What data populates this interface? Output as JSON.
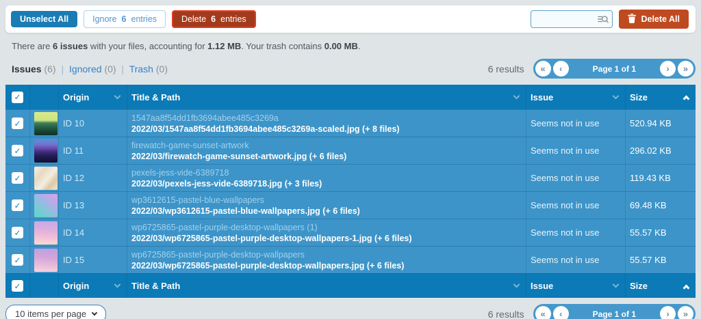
{
  "toolbar": {
    "unselect_all_label": "Unselect All",
    "ignore_button": {
      "pre": "Ignore ",
      "count": "6",
      "post": " entries"
    },
    "delete_button": {
      "pre": "Delete ",
      "count": "6",
      "post": " entries"
    },
    "search": {
      "value": "",
      "placeholder": ""
    },
    "delete_all_label": "Delete All"
  },
  "stats": {
    "part1": "There are ",
    "issues_count": "6 issues",
    "part2": " with your files, accounting for ",
    "total_size": "1.12 MB",
    "part3": ". Your trash contains ",
    "trash_size": "0.00 MB",
    "part4": "."
  },
  "tabs": {
    "issues_label": "Issues",
    "issues_count": "(6)",
    "ignored_label": "Ignored",
    "ignored_count": "(0)",
    "trash_label": "Trash",
    "trash_count": "(0)",
    "separator": "|"
  },
  "pagination": {
    "results": "6 results",
    "page_label": "Page 1 of 1",
    "first": "«",
    "prev": "‹",
    "next": "›",
    "last": "»"
  },
  "table": {
    "columns": {
      "origin": "Origin",
      "title_path": "Title & Path",
      "issue": "Issue",
      "size": "Size"
    },
    "sorted_by": "Size",
    "checkmark": "✓",
    "rows": [
      {
        "id": "ID 10",
        "thumbnail": "green-mountain-landscape",
        "title": "1547aa8f54dd1fb3694abee485c3269a",
        "path": "2022/03/1547aa8f54dd1fb3694abee485c3269a-scaled.jpg (+ 8 files)",
        "issue": "Seems not in use",
        "size": "520.94 KB"
      },
      {
        "id": "ID 11",
        "thumbnail": "firewatch-sunset-mountains",
        "title": "firewatch-game-sunset-artwork",
        "path": "2022/03/firewatch-game-sunset-artwork.jpg (+ 6 files)",
        "issue": "Seems not in use",
        "size": "296.02 KB"
      },
      {
        "id": "ID 12",
        "thumbnail": "beige-marble-texture",
        "title": "pexels-jess-vide-6389718",
        "path": "2022/03/pexels-jess-vide-6389718.jpg (+ 3 files)",
        "issue": "Seems not in use",
        "size": "119.43 KB"
      },
      {
        "id": "ID 13",
        "thumbnail": "pastel-teal-purple-gradient",
        "title": "wp3612615-pastel-blue-wallpapers",
        "path": "2022/03/wp3612615-pastel-blue-wallpapers.jpg (+ 6 files)",
        "issue": "Seems not in use",
        "size": "69.48 KB"
      },
      {
        "id": "ID 14",
        "thumbnail": "pastel-purple-pink-gradient",
        "title": "wp6725865-pastel-purple-desktop-wallpapers (1)",
        "path": "2022/03/wp6725865-pastel-purple-desktop-wallpapers-1.jpg (+ 6 files)",
        "issue": "Seems not in use",
        "size": "55.57 KB"
      },
      {
        "id": "ID 15",
        "thumbnail": "pastel-purple-pink-gradient",
        "title": "wp6725865-pastel-purple-desktop-wallpapers",
        "path": "2022/03/wp6725865-pastel-purple-desktop-wallpapers.jpg (+ 6 files)",
        "issue": "Seems not in use",
        "size": "55.57 KB"
      }
    ]
  },
  "bottombar": {
    "items_per_page": "10 items per page"
  },
  "colors": {
    "header_blue": "#0c7ab6",
    "row_blue": "#3d94c8",
    "accent_blue": "#1a7cb5",
    "pager_blue": "#4498cc",
    "delete_red": "#a23b1c",
    "delete_all_orange": "#bf4a1f",
    "page_background": "#dfe4e7"
  }
}
